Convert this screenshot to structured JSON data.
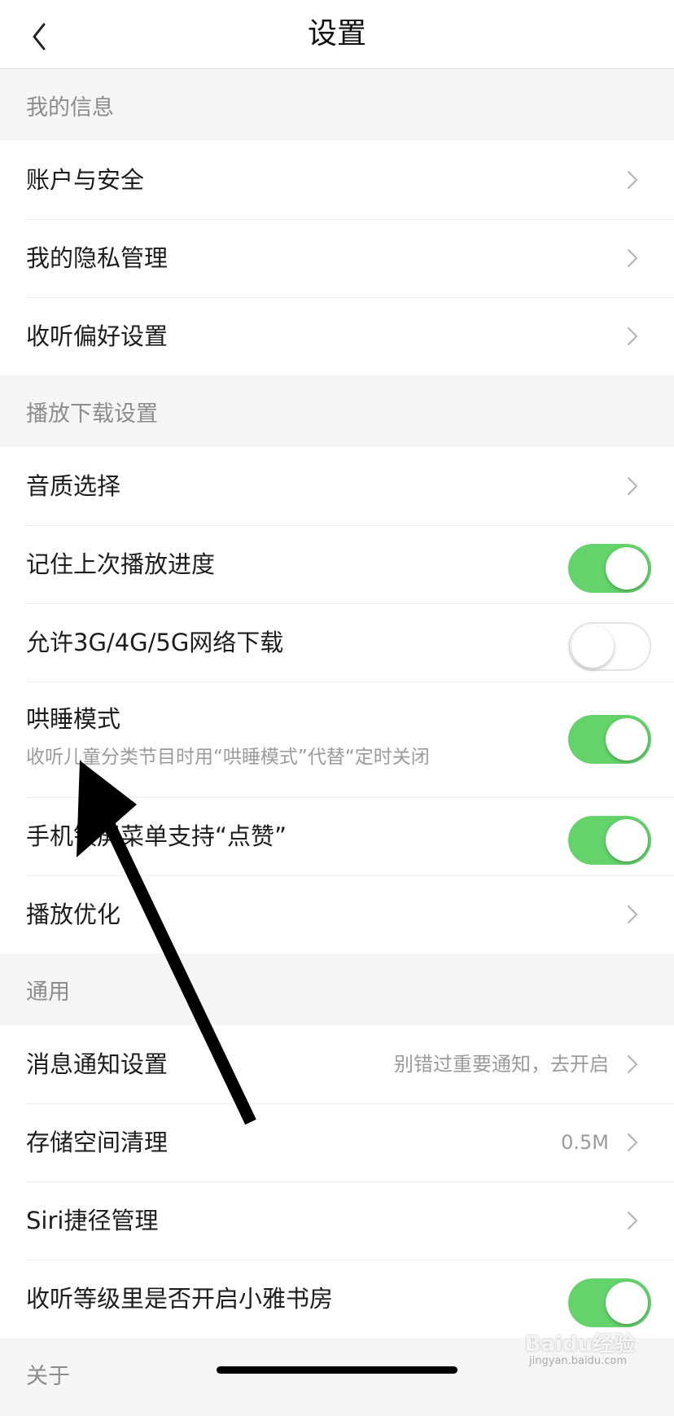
{
  "header": {
    "title": "设置",
    "back_icon": "chevron-left-icon"
  },
  "sections": {
    "my_info": {
      "title": "我的信息",
      "items": [
        "账户与安全",
        "我的隐私管理",
        "收听偏好设置"
      ]
    },
    "playback": {
      "title": "播放下载设置",
      "quality": "音质选择",
      "remember_progress": {
        "label": "记住上次播放进度",
        "state": "on"
      },
      "cellular_download": {
        "label": "允许3G/4G/5G网络下载",
        "state": "off"
      },
      "sleep_mode": {
        "label": "哄睡模式",
        "description": "收听儿童分类节目时用“哄睡模式”代替“定时关闭",
        "state": "on"
      },
      "lockscreen_like": {
        "label": "手机锁屏菜单支持“点赞”",
        "state": "on"
      },
      "optimize": "播放优化"
    },
    "general": {
      "title": "通用",
      "notifications": {
        "label": "消息通知设置",
        "trailing": "别错过重要通知，去开启"
      },
      "storage": {
        "label": "存储空间清理",
        "trailing": "0.5M"
      },
      "siri": "Siri捷径管理",
      "study_room": {
        "label": "收听等级里是否开启小雅书房",
        "state": "on"
      }
    },
    "about": {
      "title": "关于"
    }
  },
  "watermark": {
    "brand": "Baidu经验",
    "url": "jingyan.baidu.com"
  },
  "colors": {
    "toggle_on": "#64d36b",
    "section_text": "#8c8c8c",
    "annotation_arrow": "#000000"
  }
}
